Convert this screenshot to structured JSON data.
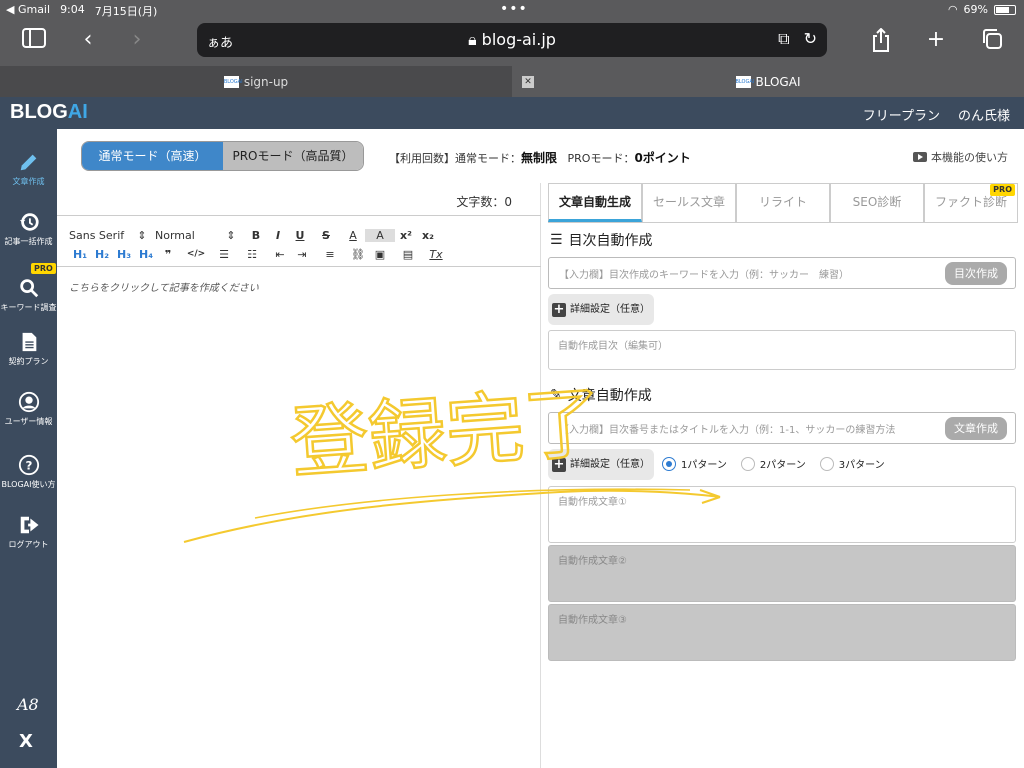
{
  "status_bar": {
    "back_app": "◀ Gmail",
    "time": "9:04",
    "date": "7月15日(月)",
    "battery": "69%"
  },
  "browser": {
    "text_size_label": "ぁあ",
    "url": "blog-ai.jp",
    "tabs": [
      {
        "title": "sign-up",
        "favicon": "BLOGAI"
      },
      {
        "title": "BLOGAI",
        "favicon": "BLOGAI"
      }
    ]
  },
  "header": {
    "logo_main": "BLOG",
    "logo_accent": "AI",
    "plan": "フリープラン",
    "user": "のん氏様"
  },
  "sidebar": {
    "items": [
      {
        "label": "文章作成",
        "icon": "pencil-icon"
      },
      {
        "label": "記事一括作成",
        "icon": "history-icon"
      },
      {
        "label": "キーワード調査",
        "icon": "search-icon",
        "badge": "PRO"
      },
      {
        "label": "契約プラン",
        "icon": "document-icon"
      },
      {
        "label": "ユーザー情報",
        "icon": "user-icon"
      },
      {
        "label": "BLOGAI使い方",
        "icon": "help-icon"
      },
      {
        "label": "ログアウト",
        "icon": "logout-icon"
      }
    ],
    "a8": "A8",
    "x": "X"
  },
  "modes": {
    "normal": "通常モード（高速）",
    "pro": "PROモード（高品質）",
    "usage_prefix": "【利用回数】通常モード：",
    "usage_normal": "無制限",
    "usage_pro_prefix": "PROモード：",
    "usage_pro": "0ポイント",
    "howto": "本機能の使い方"
  },
  "editor": {
    "char_count": "文字数：0",
    "font": "Sans Serif",
    "size": "Normal",
    "placeholder": "こちらをクリックして記事を作成ください"
  },
  "panel": {
    "tabs": [
      {
        "label": "文章自動生成",
        "active": true
      },
      {
        "label": "セールス文章"
      },
      {
        "label": "リライト"
      },
      {
        "label": "SEO診断"
      },
      {
        "label": "ファクト診断",
        "badge": "PRO"
      }
    ],
    "toc": {
      "title": "目次自動作成",
      "input_placeholder": "【入力欄】目次作成のキーワードを入力（例：サッカー　練習）",
      "button": "目次作成",
      "detail": "詳細設定（任意）",
      "output_placeholder": "自動作成目次（編集可）"
    },
    "article": {
      "title": "文章自動作成",
      "input_placeholder": "【入力欄】目次番号またはタイトルを入力（例：1-1、サッカーの練習方法",
      "button": "文章作成",
      "detail": "詳細設定（任意）",
      "patterns": [
        "1パターン",
        "2パターン",
        "3パターン"
      ],
      "outputs": [
        "自動作成文章①",
        "自動作成文章②",
        "自動作成文章③"
      ]
    }
  },
  "handwriting": "登録完了"
}
